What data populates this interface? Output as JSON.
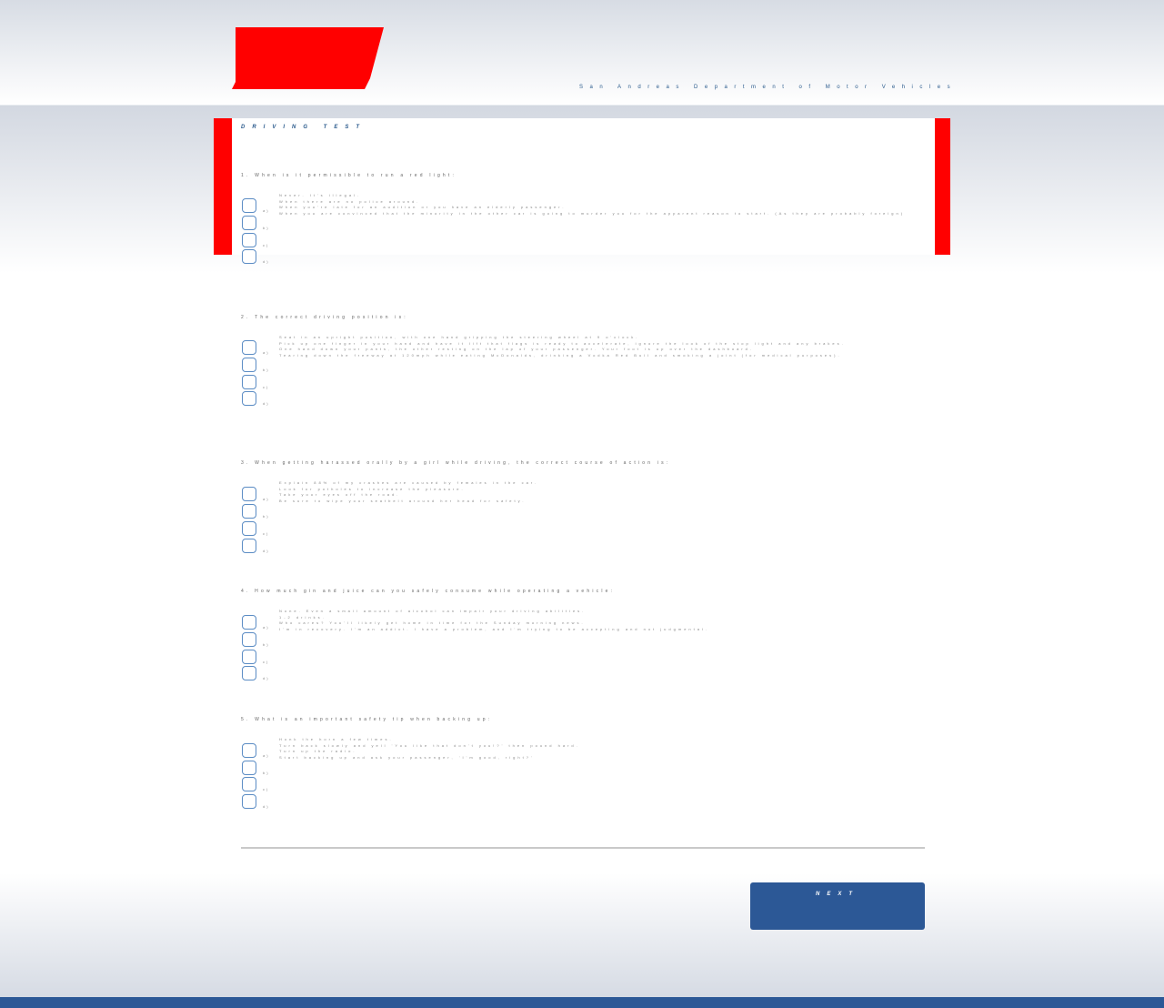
{
  "header": {
    "department_title": "San Andreas Department of Motor Vehicles"
  },
  "page": {
    "title": "DRIVING TEST"
  },
  "questions": [
    {
      "text": "1. When is it permissible to run a red light:",
      "answers": [
        "Never. It's illegal.",
        "When there are no police around.",
        "When you're late for an audition or you have an elderly passenger.",
        "When you are convinced that the minority in the other car is going to murder you for the apparent reason to start. (As they are probably foreign)"
      ],
      "letters": [
        "a)",
        "b)",
        "c)",
        "d)"
      ]
    },
    {
      "text": "2. The correct driving position is:",
      "answers": [
        "Seat in an upright position, with one hand gripping the steering wheel at 9 o'clock.",
        "Pick up one finger in your hand and have it lift that flags is ready to accelerate, ignore the look of the stop light and any brakes.",
        "One hand down your pants, the other resting on the lap of your passenger. Your foot is up over the dashboard.",
        "Tearing down the freeway at 120mph while eating McDonalds, drinking a Vodka Red Bull and smoking a joint (for medical purposes)."
      ],
      "letters": [
        "a)",
        "b)",
        "c)",
        "d)"
      ]
    },
    {
      "text": "3. When getting harassed orally by a girl while driving, the correct course of action is:",
      "answers": [
        "Explain 88% of my crashes are caused by females in the car.",
        "Look for potholes to increase the pleasure.",
        "Take your eyes off the road.",
        "Be sure to wipe your seatbelt around her head for safety."
      ],
      "letters": [
        "a)",
        "b)",
        "c)",
        "d)"
      ]
    },
    {
      "text": "4. How much gin and juice can you safely consume while operating a vehicle:",
      "answers": [
        "None. Even a small amount of alcohol can impair your driving abilities.",
        "1-2 drinks.",
        "Who cares? You'll likely get home in time for the Sunday morning news.",
        "I'm in recovery. I'm an addict. I have a problem, and I'm trying to be accepting and not judgmental."
      ],
      "letters": [
        "a)",
        "b)",
        "c)",
        "d)"
      ]
    },
    {
      "text": "5. What is an important safety tip when backing up:",
      "answers": [
        "Honk the horn a few times.",
        "Turn back slowly and yell 'You like that don't you!?' then pound hard.",
        "Turn up the radio.",
        "Start backing up and ask your passenger, 'I'm good, right?'"
      ],
      "letters": [
        "a)",
        "b)",
        "c)",
        "d)"
      ]
    }
  ],
  "footer": {
    "next_label": "NEXT"
  },
  "colors": {
    "accent_red": "#ff0000",
    "brand_blue": "#2c5896",
    "checkbox_border": "#5b8cc4"
  }
}
